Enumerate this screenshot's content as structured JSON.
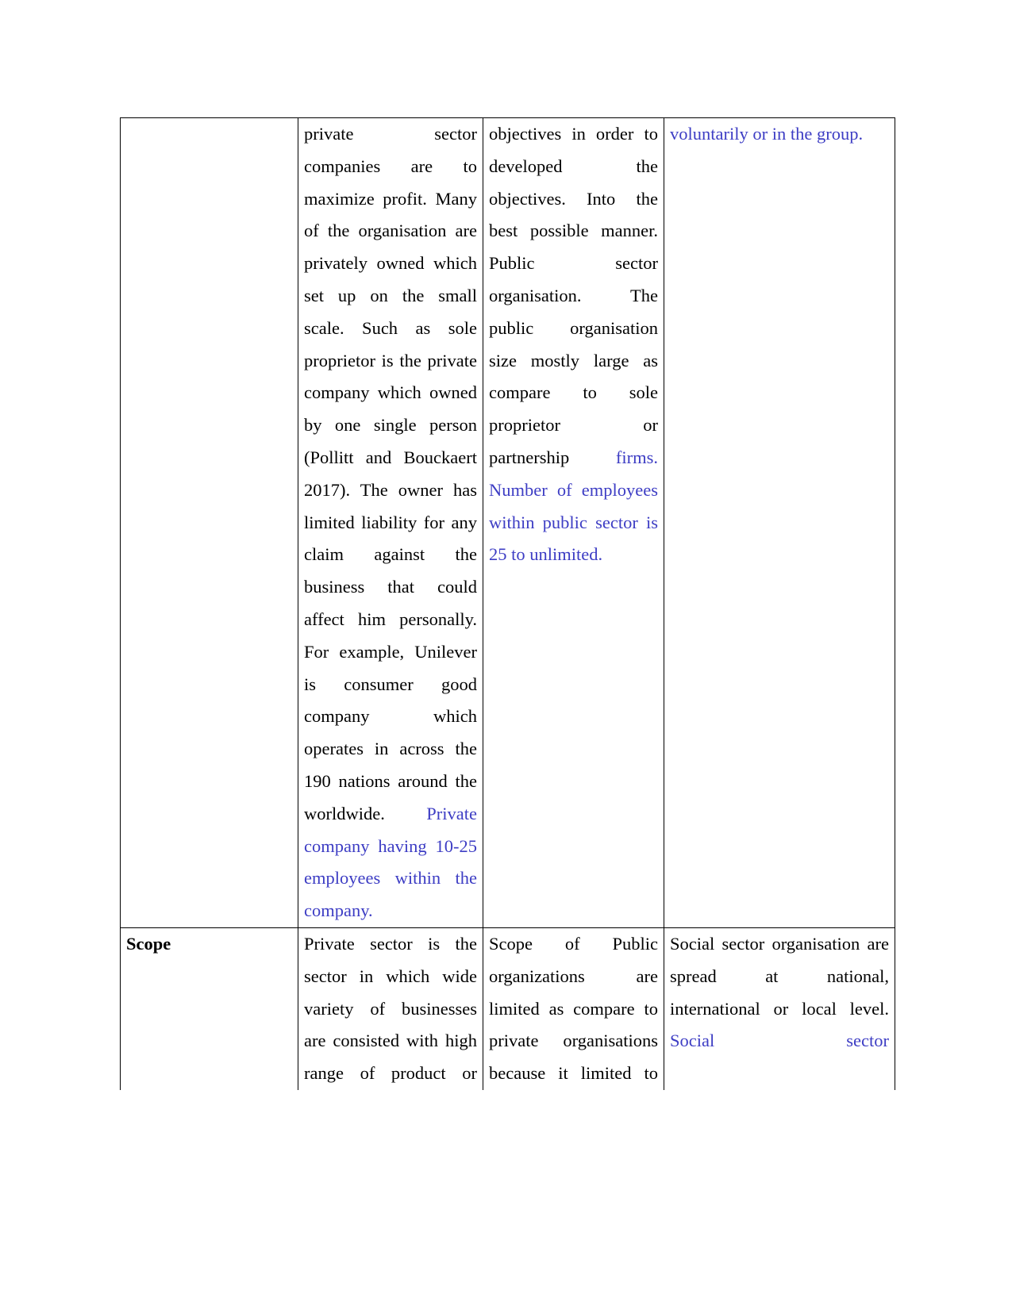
{
  "document": {
    "type": "comparison-table",
    "page_background": "#ffffff",
    "text_color": "#000000",
    "highlight_color": "#3d3dc4",
    "columns": 4
  },
  "table": {
    "rows": [
      {
        "id": "continued-row",
        "label": "",
        "cells": {
          "label": "",
          "private_sector": {
            "segments": [
              {
                "text": "private sector companies are to maximize profit. Many of the organisation are privately owned which set up on the small scale. Such as sole proprietor is the private company which owned by one single person (Pollitt and Bouckaert 2017). The owner has limited liability for any claim against the business that could affect him personally. For example, Unilever is consumer good company which operates in across the 190 nations around the worldwide. ",
                "style": "normal"
              },
              {
                "text": "Private company having 10-25 employees within the company.",
                "style": "highlight"
              }
            ]
          },
          "public_sector": {
            "segments": [
              {
                "text": "objectives in order to developed the objectives. Into the best possible manner. Public sector organisation. The public organisation size mostly large as compare to sole proprietor or partnership ",
                "style": "normal"
              },
              {
                "text": "firms. Number of employees within public sector is 25 to unlimited.",
                "style": "highlight"
              }
            ]
          },
          "social_sector": {
            "segments": [
              {
                "text": "voluntarily or in the group.",
                "style": "highlight"
              }
            ]
          }
        }
      },
      {
        "id": "scope-row",
        "label": "Scope",
        "cells": {
          "label": "Scope",
          "private_sector": {
            "segments": [
              {
                "text": "Private sector is the sector in which wide variety of businesses are consisted with high range of product or",
                "style": "normal"
              }
            ]
          },
          "public_sector": {
            "segments": [
              {
                "text": "Scope of Public organizations are limited as compare to private organisations because it limited to",
                "style": "normal"
              }
            ]
          },
          "social_sector": {
            "segments": [
              {
                "text": "Social sector organisation are spread at national, international or local level. ",
                "style": "normal"
              },
              {
                "text": "Social sector",
                "style": "highlight"
              }
            ]
          }
        }
      }
    ]
  }
}
